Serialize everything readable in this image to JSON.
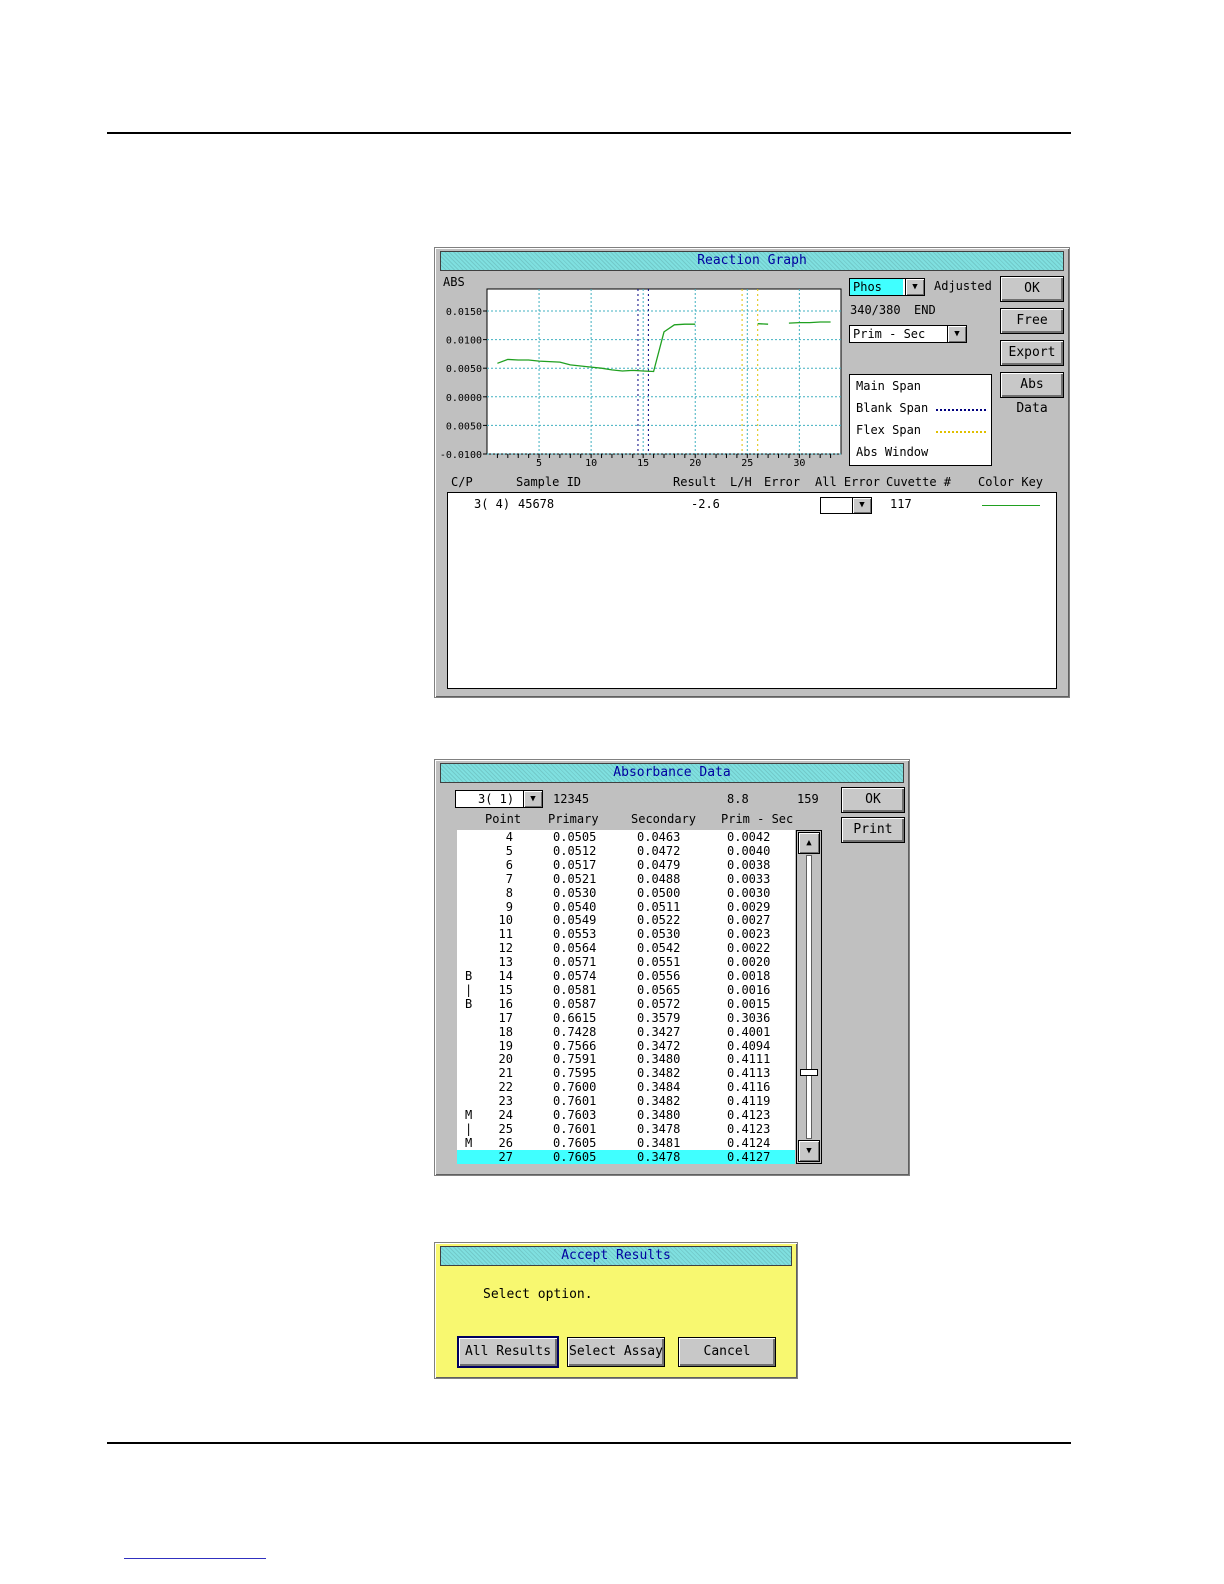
{
  "reaction_graph": {
    "title": "Reaction Graph",
    "abs_label": "ABS",
    "assay_select": "Phos",
    "adjusted_label": "Adjusted",
    "wavelength": "340/380",
    "end_label": "END",
    "mode_select": "Prim - Sec",
    "buttons": {
      "ok": "OK",
      "free": "Free",
      "export": "Export",
      "abs_data": "Abs Data"
    },
    "legend": {
      "main_span": "Main Span",
      "blank_span": "Blank Span",
      "flex_span": "Flex Span",
      "abs_window": "Abs Window"
    },
    "columns": {
      "cp": "C/P",
      "sample_id": "Sample ID",
      "result": "Result",
      "lh": "L/H",
      "error": "Error",
      "all_error": "All Error",
      "cuvette": "Cuvette #",
      "color_key": "Color Key"
    },
    "row": {
      "cp": "3( 4)",
      "sample_id": "45678",
      "result": "-2.6",
      "cuvette": "117"
    },
    "colors": {
      "trace": "#20a020",
      "grid": "#40b0c0",
      "blank": "#000080",
      "flex": "#e0c000"
    }
  },
  "chart_data": {
    "type": "line",
    "x": [
      1,
      2,
      3,
      4,
      5,
      6,
      7,
      8,
      9,
      10,
      11,
      12,
      13,
      14,
      15,
      16,
      17,
      18,
      19,
      20,
      21,
      22,
      23,
      24,
      25,
      26,
      27,
      28,
      29,
      30,
      31,
      32,
      33
    ],
    "series": [
      {
        "values": [
          0.0065,
          0.0072,
          0.0071,
          0.0071,
          0.0069,
          0.0068,
          0.0067,
          0.0062,
          0.006,
          0.0058,
          0.0056,
          0.0053,
          0.0051,
          0.0052,
          0.0051,
          0.005,
          0.0122,
          0.0135,
          0.0136,
          0.0136,
          null,
          null,
          null,
          null,
          null,
          0.0137,
          0.0136,
          null,
          0.0138,
          0.0139,
          0.0139,
          0.014,
          0.014
        ]
      }
    ],
    "ylabel": "ABS",
    "yticks": [
      "0.0150",
      "0.0100",
      "0.0050",
      "0.0000",
      "0.0050",
      "-0.0100"
    ],
    "xticks": [
      5,
      10,
      15,
      20,
      25,
      30
    ],
    "ylim": [
      -0.01,
      0.02
    ],
    "xlim": [
      0,
      34
    ],
    "blank_span_lines": [
      14.5,
      15.5
    ],
    "flex_span_lines": [
      24.5,
      26
    ]
  },
  "absorbance": {
    "title": "Absorbance Data",
    "select": "3( 1)",
    "sample_id": "12345",
    "value": "8.8",
    "cuvette": "159",
    "buttons": {
      "ok": "OK",
      "print": "Print"
    },
    "columns": {
      "point": "Point",
      "primary": "Primary",
      "secondary": "Secondary",
      "prim_sec": "Prim - Sec"
    },
    "rows": [
      {
        "flag": "",
        "point": "4",
        "primary": "0.0505",
        "secondary": "0.0463",
        "diff": "0.0042"
      },
      {
        "flag": "",
        "point": "5",
        "primary": "0.0512",
        "secondary": "0.0472",
        "diff": "0.0040"
      },
      {
        "flag": "",
        "point": "6",
        "primary": "0.0517",
        "secondary": "0.0479",
        "diff": "0.0038"
      },
      {
        "flag": "",
        "point": "7",
        "primary": "0.0521",
        "secondary": "0.0488",
        "diff": "0.0033"
      },
      {
        "flag": "",
        "point": "8",
        "primary": "0.0530",
        "secondary": "0.0500",
        "diff": "0.0030"
      },
      {
        "flag": "",
        "point": "9",
        "primary": "0.0540",
        "secondary": "0.0511",
        "diff": "0.0029"
      },
      {
        "flag": "",
        "point": "10",
        "primary": "0.0549",
        "secondary": "0.0522",
        "diff": "0.0027"
      },
      {
        "flag": "",
        "point": "11",
        "primary": "0.0553",
        "secondary": "0.0530",
        "diff": "0.0023"
      },
      {
        "flag": "",
        "point": "12",
        "primary": "0.0564",
        "secondary": "0.0542",
        "diff": "0.0022"
      },
      {
        "flag": "",
        "point": "13",
        "primary": "0.0571",
        "secondary": "0.0551",
        "diff": "0.0020"
      },
      {
        "flag": "B",
        "point": "14",
        "primary": "0.0574",
        "secondary": "0.0556",
        "diff": "0.0018"
      },
      {
        "flag": "|",
        "point": "15",
        "primary": "0.0581",
        "secondary": "0.0565",
        "diff": "0.0016"
      },
      {
        "flag": "B",
        "point": "16",
        "primary": "0.0587",
        "secondary": "0.0572",
        "diff": "0.0015"
      },
      {
        "flag": "",
        "point": "17",
        "primary": "0.6615",
        "secondary": "0.3579",
        "diff": "0.3036"
      },
      {
        "flag": "",
        "point": "18",
        "primary": "0.7428",
        "secondary": "0.3427",
        "diff": "0.4001"
      },
      {
        "flag": "",
        "point": "19",
        "primary": "0.7566",
        "secondary": "0.3472",
        "diff": "0.4094"
      },
      {
        "flag": "",
        "point": "20",
        "primary": "0.7591",
        "secondary": "0.3480",
        "diff": "0.4111"
      },
      {
        "flag": "",
        "point": "21",
        "primary": "0.7595",
        "secondary": "0.3482",
        "diff": "0.4113"
      },
      {
        "flag": "",
        "point": "22",
        "primary": "0.7600",
        "secondary": "0.3484",
        "diff": "0.4116"
      },
      {
        "flag": "",
        "point": "23",
        "primary": "0.7601",
        "secondary": "0.3482",
        "diff": "0.4119"
      },
      {
        "flag": "M",
        "point": "24",
        "primary": "0.7603",
        "secondary": "0.3480",
        "diff": "0.4123"
      },
      {
        "flag": "|",
        "point": "25",
        "primary": "0.7601",
        "secondary": "0.3478",
        "diff": "0.4123"
      },
      {
        "flag": "M",
        "point": "26",
        "primary": "0.7605",
        "secondary": "0.3481",
        "diff": "0.4124"
      },
      {
        "flag": "",
        "point": "27",
        "primary": "0.7605",
        "secondary": "0.3478",
        "diff": "0.4127"
      }
    ],
    "selected_row": 23,
    "scroll_position": 0.77
  },
  "accept": {
    "title": "Accept Results",
    "message": "Select option.",
    "buttons": {
      "all": "All Results",
      "select": "Select Assay",
      "cancel": "Cancel"
    }
  }
}
